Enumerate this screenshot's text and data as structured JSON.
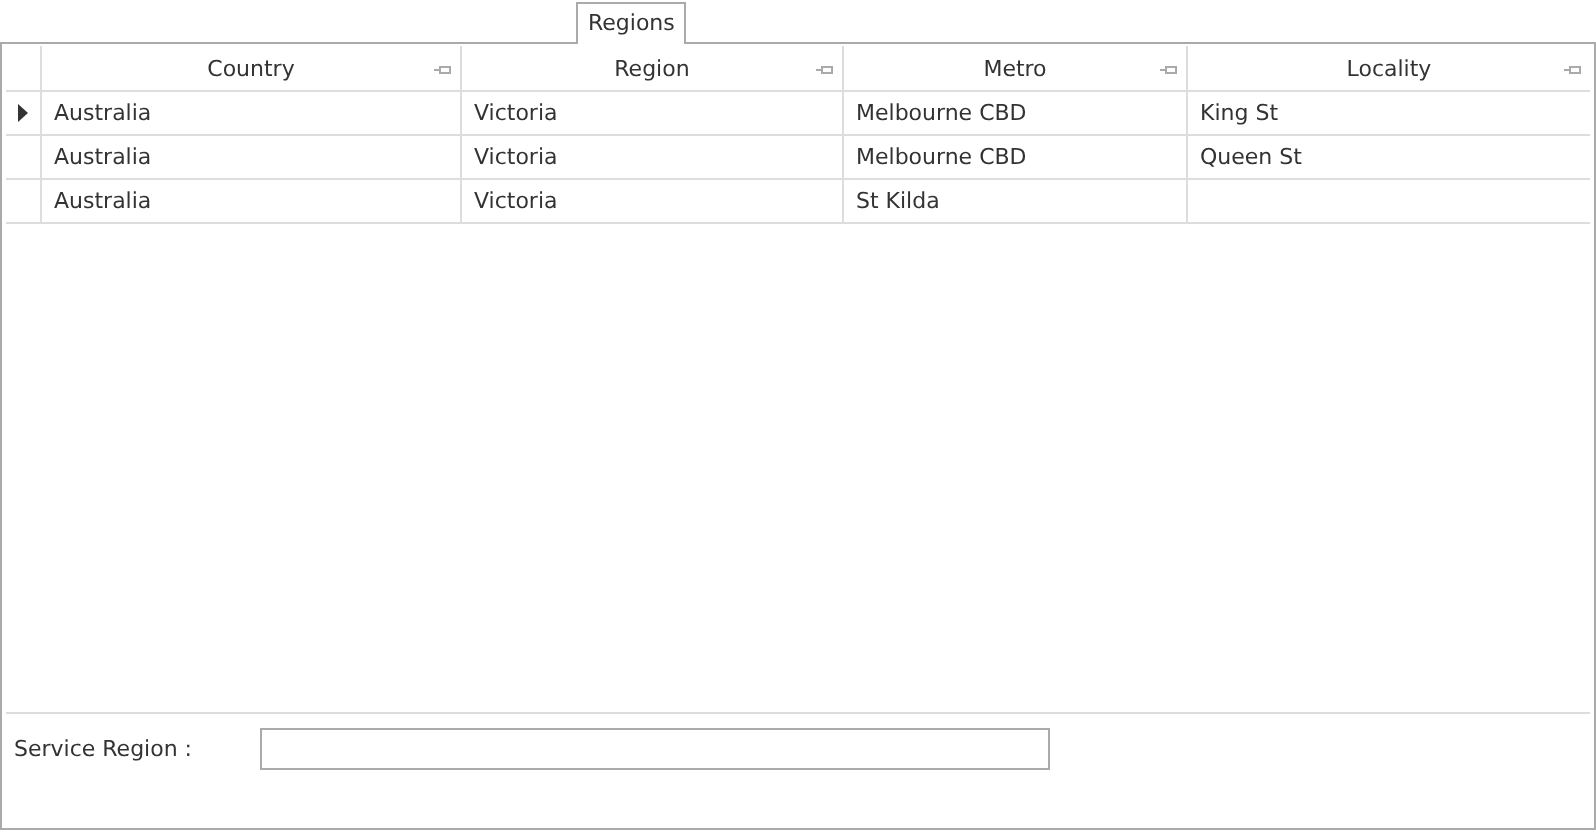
{
  "tab": {
    "label": "Regions",
    "selected": true
  },
  "table": {
    "columns": [
      {
        "label": "Country"
      },
      {
        "label": "Region"
      },
      {
        "label": "Metro"
      },
      {
        "label": "Locality"
      }
    ],
    "rows": [
      {
        "current": true,
        "cells": [
          "Australia",
          "Victoria",
          "Melbourne CBD",
          "King St"
        ]
      },
      {
        "current": false,
        "cells": [
          "Australia",
          "Victoria",
          "Melbourne CBD",
          "Queen St"
        ]
      },
      {
        "current": false,
        "cells": [
          "Australia",
          "Victoria",
          "St Kilda",
          ""
        ]
      }
    ]
  },
  "service_region": {
    "label": "Service Region :"
  }
}
